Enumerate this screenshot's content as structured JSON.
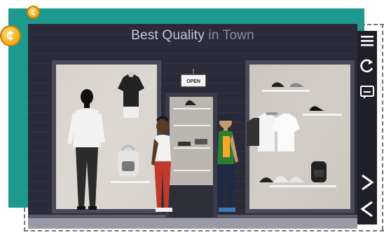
{
  "store": {
    "sign_main": "Best Quality",
    "sign_faded": "in Town",
    "door_sign": "OPEN"
  },
  "toolbar": {
    "items": [
      {
        "icon": "menu-icon"
      },
      {
        "icon": "refresh-icon"
      },
      {
        "icon": "chat-icon"
      },
      {
        "icon": "next-arrow-icon"
      },
      {
        "icon": "back-arrow-icon"
      }
    ]
  },
  "colors": {
    "teal": "#1d9a8e",
    "coin": "#f2a917",
    "wall": "#2a2a38",
    "toolbar": "#1f1f29"
  }
}
